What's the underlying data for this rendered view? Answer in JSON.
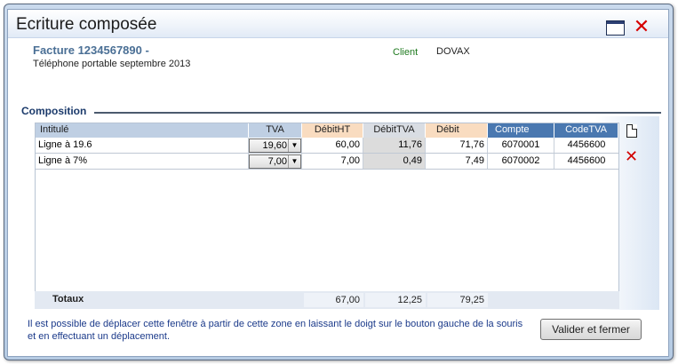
{
  "window": {
    "title": "Ecriture composée"
  },
  "invoice": {
    "title": "Facture 1234567890 -",
    "subtitle": "Téléphone portable septembre 2013",
    "client_label": "Client",
    "client_value": "DOVAX"
  },
  "composition": {
    "section_title": "Composition",
    "columns": [
      "Intitulé",
      "TVA",
      "DébitHT",
      "DébitTVA",
      "Débit",
      "Compte",
      "CodeTVA"
    ],
    "column_colors": {
      "Intitulé": "#bfcfe3",
      "TVA": "#bfcfe3",
      "DébitHT": "#f9dcc0",
      "DébitTVA": "#d9dde3",
      "Débit": "#f9dcc0",
      "Compte": "#4a78b0",
      "CodeTVA": "#4a78b0"
    },
    "rows": [
      {
        "intitule": "Ligne à 19.6",
        "tva": "19,60",
        "debit_ht": "60,00",
        "debit_tva": "11,76",
        "debit": "71,76",
        "compte": "6070001",
        "code_tva": "4456600"
      },
      {
        "intitule": "Ligne à 7%",
        "tva": "7,00",
        "debit_ht": "7,00",
        "debit_tva": "0,49",
        "debit": "7,49",
        "compte": "6070002",
        "code_tva": "4456600"
      }
    ],
    "totals": {
      "label": "Totaux",
      "debit_ht": "67,00",
      "debit_tva": "12,25",
      "debit": "79,25"
    }
  },
  "icons": {
    "new_row": "new-document-icon",
    "delete_row": "delete-cross-icon",
    "window_mode": "window-icon",
    "close": "close-cross-icon"
  },
  "footer": {
    "note_line1": "Il est possible de déplacer cette fenêtre à partir de cette zone en laissant le doigt sur le bouton gauche de la souris",
    "note_line2": "et en effectuant un déplacement.",
    "button_label": "Valider et fermer"
  }
}
